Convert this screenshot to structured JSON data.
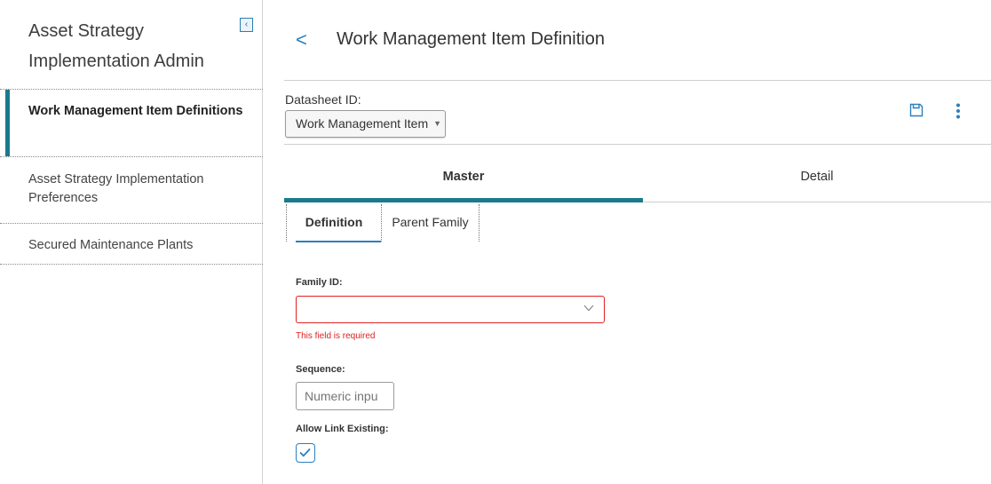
{
  "sidebar": {
    "title": "Asset Strategy Implementation Admin",
    "collapse_icon": "collapse-left-icon",
    "items": [
      {
        "label": "Work Management Item Definitions",
        "active": true
      },
      {
        "label": "Asset Strategy Implementation Preferences",
        "active": false
      },
      {
        "label": "Secured Maintenance Plants",
        "active": false
      }
    ]
  },
  "header": {
    "back_icon": "chevron-left-icon",
    "title": "Work Management Item Definition"
  },
  "datasheet": {
    "label": "Datasheet ID:",
    "value": "Work Management Item"
  },
  "toolbar": {
    "save_icon": "save-icon",
    "more_icon": "more-vertical-icon"
  },
  "tabs": [
    {
      "label": "Master",
      "active": true
    },
    {
      "label": "Detail",
      "active": false
    }
  ],
  "subtabs": [
    {
      "label": "Definition",
      "active": true
    },
    {
      "label": "Parent Family",
      "active": false
    }
  ],
  "form": {
    "family_id": {
      "label": "Family ID:",
      "value": "",
      "error": "This field is required"
    },
    "sequence": {
      "label": "Sequence:",
      "placeholder": "Numeric inpu"
    },
    "allow_link_existing": {
      "label": "Allow Link Existing:",
      "checked": true
    }
  },
  "colors": {
    "accent": "#1a7a8c",
    "link": "#2a7fbf",
    "error": "#e02020"
  }
}
